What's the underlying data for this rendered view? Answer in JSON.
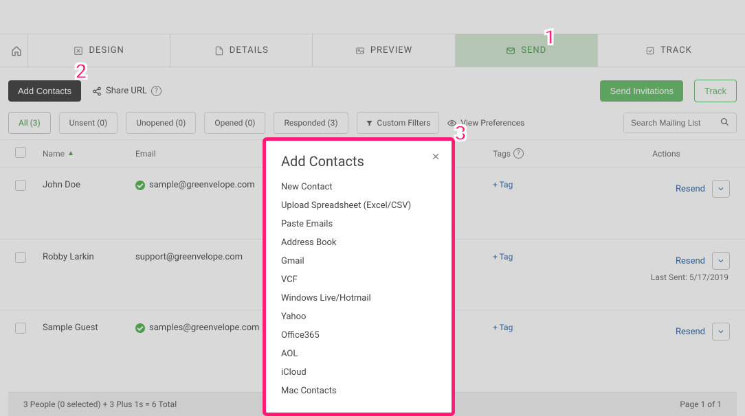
{
  "nav": {
    "design": "DESIGN",
    "details": "DETAILS",
    "preview": "PREVIEW",
    "send": "SEND",
    "track": "TRACK"
  },
  "toolbar": {
    "addContacts": "Add Contacts",
    "shareUrl": "Share URL",
    "sendInvitations": "Send Invitations",
    "track": "Track"
  },
  "filters": {
    "all": "All (3)",
    "unsent": "Unsent (0)",
    "unopened": "Unopened (0)",
    "opened": "Opened (0)",
    "responded": "Responded (3)",
    "custom": "Custom Filters",
    "viewPrefs": "View Preferences"
  },
  "search": {
    "placeholder": "Search Mailing List"
  },
  "columns": {
    "name": "Name",
    "email": "Email",
    "tags": "Tags",
    "actions": "Actions"
  },
  "rows": [
    {
      "name": "John Doe",
      "email": "sample@greenvelope.com",
      "verified": true,
      "tag": "+ Tag",
      "resend": "Resend",
      "lastSent": ""
    },
    {
      "name": "Robby Larkin",
      "email": "support@greenvelope.com",
      "verified": false,
      "tag": "+ Tag",
      "resend": "Resend",
      "lastSent": "Last Sent: 5/17/2019"
    },
    {
      "name": "Sample Guest",
      "email": "samples@greenvelope.com",
      "verified": true,
      "tag": "+ Tag",
      "resend": "Resend",
      "lastSent": ""
    }
  ],
  "footer": {
    "summary": "3 People (0 selected) + 3 Plus 1s = 6 Total",
    "pagination": "Page 1 of 1"
  },
  "modal": {
    "title": "Add Contacts",
    "items": [
      "New Contact",
      "Upload Spreadsheet (Excel/CSV)",
      "Paste Emails",
      "Address Book",
      "Gmail",
      "VCF",
      "Windows Live/Hotmail",
      "Yahoo",
      "Office365",
      "AOL",
      "iCloud",
      "Mac Contacts"
    ]
  },
  "callouts": {
    "c1": "1",
    "c2": "2",
    "c3": "3"
  }
}
